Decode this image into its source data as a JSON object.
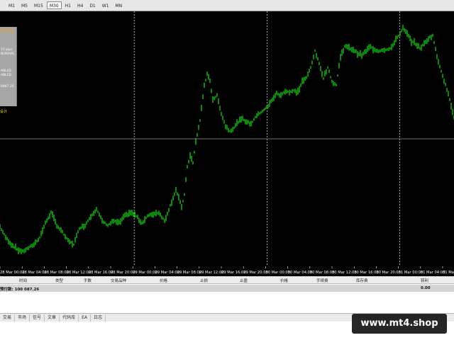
{
  "toolbar": {
    "timeframes": [
      "M1",
      "M5",
      "M15",
      "M30",
      "H1",
      "H4",
      "D1",
      "W1",
      "MN"
    ],
    "active_timeframe": "M30"
  },
  "info_panel": {
    "title": "ATC EA",
    "lines": [
      "15 pips",
      "NORMAL",
      "ABLED",
      "ABLED",
      "0087.26"
    ],
    "footer": "设计"
  },
  "chart_data": {
    "type": "ohlc",
    "xlabel": "",
    "ylabel": "",
    "x_ticks": [
      "28 Mar 00:00",
      "28 Mar 04:00",
      "28 Mar 08:00",
      "28 Mar 12:00",
      "28 Mar 16:00",
      "28 Mar 20:00",
      "29 Mar 00:00",
      "29 Mar 04:00",
      "29 Mar 08:00",
      "29 Mar 12:00",
      "29 Mar 16:00",
      "29 Mar 20:00",
      "30 Mar 00:00",
      "30 Mar 04:00",
      "30 Mar 08:00",
      "30 Mar 12:00",
      "30 Mar 16:00",
      "30 Mar 20:00",
      "31 Mar 00:00",
      "31 Mar 04:00",
      "31 Mar 08:00"
    ],
    "period_separators": [
      "29 Mar 00:00",
      "30 Mar 00:00",
      "31 Mar 00:00"
    ],
    "price_path": [
      [
        0,
        320
      ],
      [
        8,
        335
      ],
      [
        16,
        345
      ],
      [
        24,
        352
      ],
      [
        32,
        355
      ],
      [
        40,
        350
      ],
      [
        48,
        345
      ],
      [
        56,
        335
      ],
      [
        64,
        315
      ],
      [
        72,
        300
      ],
      [
        80,
        318
      ],
      [
        88,
        328
      ],
      [
        96,
        340
      ],
      [
        104,
        345
      ],
      [
        112,
        322
      ],
      [
        120,
        318
      ],
      [
        128,
        305
      ],
      [
        136,
        295
      ],
      [
        144,
        312
      ],
      [
        152,
        318
      ],
      [
        160,
        312
      ],
      [
        168,
        315
      ],
      [
        176,
        305
      ],
      [
        184,
        300
      ],
      [
        192,
        305
      ],
      [
        200,
        315
      ],
      [
        208,
        305
      ],
      [
        216,
        302
      ],
      [
        224,
        300
      ],
      [
        232,
        312
      ],
      [
        240,
        290
      ],
      [
        248,
        268
      ],
      [
        256,
        292
      ],
      [
        260,
        275
      ],
      [
        264,
        235
      ],
      [
        268,
        220
      ],
      [
        272,
        230
      ],
      [
        276,
        200
      ],
      [
        282,
        170
      ],
      [
        288,
        120
      ],
      [
        292,
        105
      ],
      [
        296,
        115
      ],
      [
        300,
        140
      ],
      [
        306,
        135
      ],
      [
        312,
        160
      ],
      [
        318,
        178
      ],
      [
        324,
        185
      ],
      [
        330,
        180
      ],
      [
        336,
        172
      ],
      [
        342,
        168
      ],
      [
        348,
        172
      ],
      [
        354,
        175
      ],
      [
        360,
        165
      ],
      [
        366,
        160
      ],
      [
        372,
        155
      ],
      [
        378,
        150
      ],
      [
        384,
        140
      ],
      [
        390,
        132
      ],
      [
        396,
        135
      ],
      [
        402,
        128
      ],
      [
        408,
        130
      ],
      [
        414,
        128
      ],
      [
        420,
        130
      ],
      [
        426,
        115
      ],
      [
        432,
        110
      ],
      [
        438,
        95
      ],
      [
        444,
        72
      ],
      [
        450,
        90
      ],
      [
        456,
        110
      ],
      [
        462,
        95
      ],
      [
        468,
        115
      ],
      [
        474,
        120
      ],
      [
        480,
        80
      ],
      [
        486,
        65
      ],
      [
        492,
        68
      ],
      [
        498,
        70
      ],
      [
        504,
        75
      ],
      [
        510,
        78
      ],
      [
        516,
        72
      ],
      [
        522,
        66
      ],
      [
        528,
        70
      ],
      [
        534,
        72
      ],
      [
        540,
        70
      ],
      [
        546,
        70
      ],
      [
        552,
        68
      ],
      [
        558,
        55
      ],
      [
        564,
        48
      ],
      [
        568,
        40
      ],
      [
        574,
        48
      ],
      [
        580,
        58
      ],
      [
        586,
        62
      ],
      [
        592,
        68
      ],
      [
        598,
        62
      ],
      [
        604,
        54
      ],
      [
        610,
        50
      ],
      [
        616,
        80
      ],
      [
        622,
        100
      ],
      [
        628,
        120
      ],
      [
        634,
        140
      ],
      [
        640,
        165
      ]
    ]
  },
  "terminal": {
    "columns": [
      "时间",
      "类型",
      "手数",
      "交易品种",
      "价格",
      "止损",
      "止盈",
      "价格",
      "手续费",
      "库存费",
      "获利"
    ],
    "balance_label": "预付款: 100 087.26",
    "profit_value": "0.00"
  },
  "tabs": [
    "交易",
    "市场",
    "信号",
    "文章",
    "代码库",
    "EA",
    "日志"
  ],
  "watermark": "www.mt4.shop",
  "colors": {
    "candle": "#19e019",
    "background": "#000000",
    "grid_separator": "#c8c8c8"
  }
}
